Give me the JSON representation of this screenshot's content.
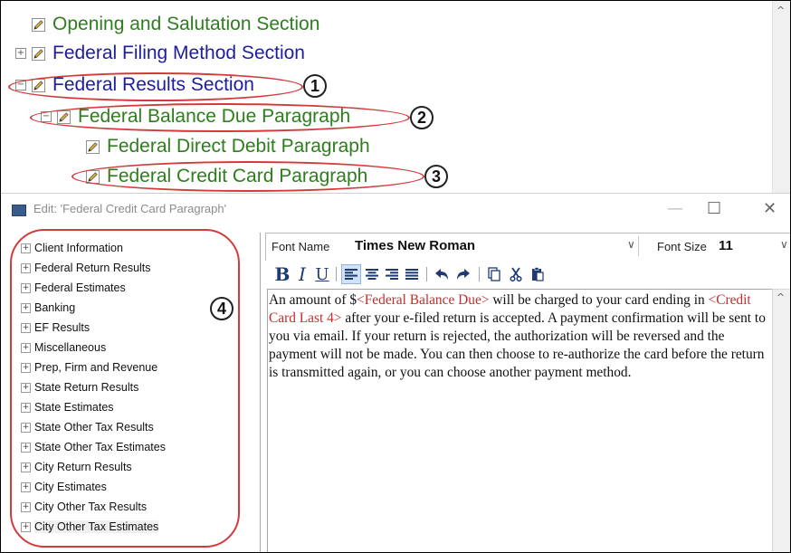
{
  "top_tree": {
    "items": [
      {
        "label": "Opening and Salutation Section"
      },
      {
        "label": "Federal Filing Method Section",
        "expander": "+"
      },
      {
        "label": "Federal Results Section",
        "expander": "−"
      },
      {
        "label": "Federal Balance Due Paragraph",
        "expander": "−"
      },
      {
        "label": "Federal Direct Debit Paragraph"
      },
      {
        "label": "Federal Credit Card Paragraph"
      }
    ]
  },
  "annotations": [
    "1",
    "2",
    "3",
    "4"
  ],
  "edit_window": {
    "title": "Edit: 'Federal Credit Card Paragraph'",
    "controls": {
      "minimize": "—",
      "maximize": "☐",
      "close": "✕"
    }
  },
  "field_tree": {
    "items": [
      "Client Information",
      "Federal Return Results",
      "Federal Estimates",
      "Banking",
      "EF Results",
      "Miscellaneous",
      "Prep, Firm and Revenue",
      "State Return Results",
      "State Estimates",
      "State Other Tax Results",
      "State Other Tax Estimates",
      "City Return Results",
      "City Estimates",
      "City Other Tax Results",
      "City Other Tax Estimates"
    ],
    "expander": "+"
  },
  "formatting": {
    "font_name_label": "Font Name",
    "font_name_value": "Times New Roman",
    "font_size_label": "Font Size",
    "font_size_value": "11",
    "bold": "B",
    "italic": "I",
    "underline": "U"
  },
  "editor": {
    "t1": "An amount of $",
    "f1": "<Federal Balance Due>",
    "t2": " will be charged to your card ending in ",
    "f2": "<Credit Card Last 4>",
    "t3": " after your e-filed return is accepted. A payment confirmation will be sent to you via email. If your return is rejected, the authorization will be reversed and the payment will not be made. You can then choose to re-authorize the card before the return is transmitted again, or you can choose another payment method."
  },
  "colors": {
    "section_green": "#2e7d1e",
    "section_blue": "#1d1d9e",
    "annotation_red": "#d33a3a",
    "field_red": "#c22d2d"
  },
  "icons": {
    "tree_item": "pencil-icon",
    "scroll_up": "chevron-up-icon",
    "dropdown": "chevron-down-icon"
  }
}
